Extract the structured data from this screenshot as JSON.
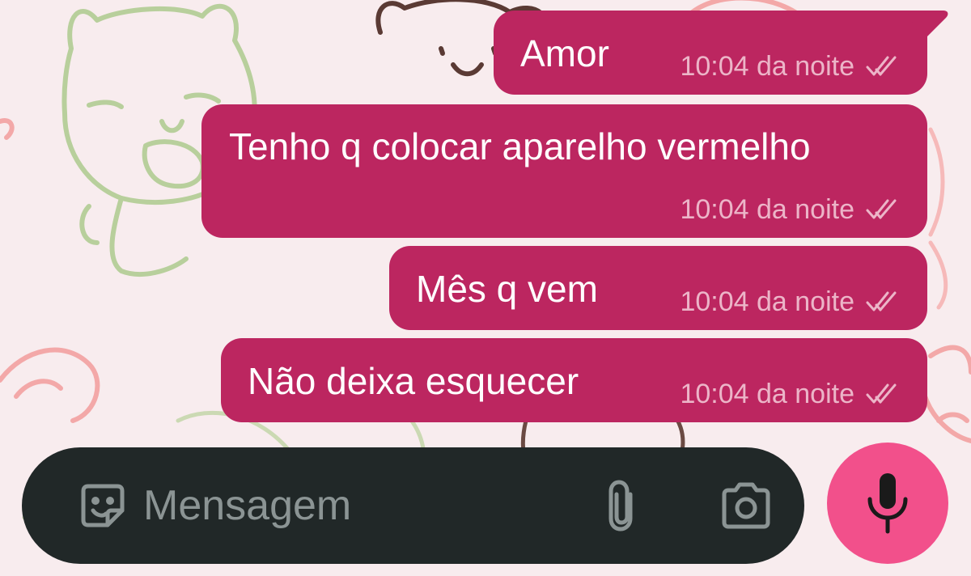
{
  "messages": [
    {
      "text": "Amor",
      "time": "10:04 da noite",
      "status": "read"
    },
    {
      "text": "Tenho q colocar aparelho vermelho",
      "time": "10:04 da noite",
      "status": "read"
    },
    {
      "text": "Mês q vem",
      "time": "10:04 da noite",
      "status": "read"
    },
    {
      "text": "Não deixa esquecer",
      "time": "10:04 da noite",
      "status": "read"
    }
  ],
  "composer": {
    "placeholder": "Mensagem",
    "emoji_icon": "sticker-emoji-icon",
    "attach_icon": "paperclip-icon",
    "camera_icon": "camera-icon",
    "mic_icon": "microphone-icon"
  },
  "colors": {
    "bubble": "#bc2660",
    "time_text": "#ecb5c8",
    "background": "#f8ecee",
    "input_bar": "#212828",
    "mic_button": "#f2508b"
  }
}
